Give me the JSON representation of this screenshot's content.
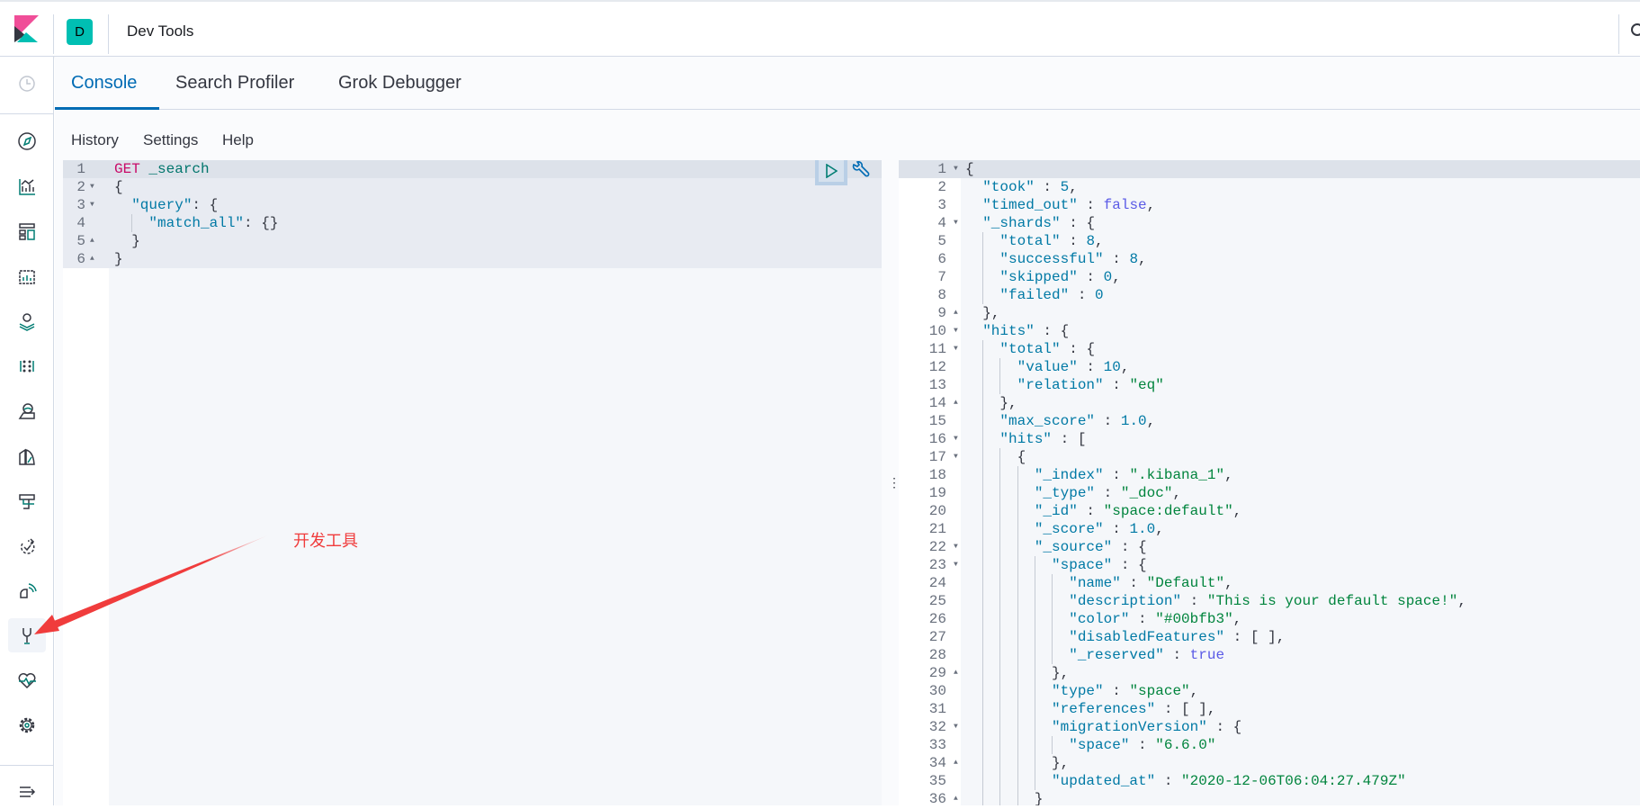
{
  "header": {
    "app_title": "Dev Tools",
    "space_initial": "D",
    "space_color": "#00bfb3"
  },
  "sidebar": {
    "items": [
      {
        "name": "recently-viewed",
        "icon": "clock-icon"
      },
      {
        "name": "discover",
        "icon": "compass-icon"
      },
      {
        "name": "visualize",
        "icon": "chart-icon"
      },
      {
        "name": "dashboard",
        "icon": "dashboard-icon"
      },
      {
        "name": "canvas",
        "icon": "canvas-icon"
      },
      {
        "name": "maps",
        "icon": "map-pin-icon"
      },
      {
        "name": "machine-learning",
        "icon": "ml-icon"
      },
      {
        "name": "siem",
        "icon": "siem-icon"
      },
      {
        "name": "logs",
        "icon": "logs-icon"
      },
      {
        "name": "infrastructure",
        "icon": "infra-icon"
      },
      {
        "name": "apm",
        "icon": "apm-icon"
      },
      {
        "name": "uptime",
        "icon": "uptime-icon"
      },
      {
        "name": "dev-tools",
        "icon": "wrench-icon",
        "active": true
      },
      {
        "name": "monitoring",
        "icon": "heartbeat-icon"
      },
      {
        "name": "management",
        "icon": "gear-icon"
      },
      {
        "name": "collapse",
        "icon": "collapse-menu-icon"
      }
    ]
  },
  "tabs": [
    {
      "label": "Console",
      "active": true
    },
    {
      "label": "Search Profiler"
    },
    {
      "label": "Grok Debugger"
    }
  ],
  "menu": {
    "history": "History",
    "settings": "Settings",
    "help": "Help"
  },
  "request": {
    "lines": [
      "GET _search",
      "{",
      "  \"query\": {",
      "    \"match_all\": {}",
      "  }",
      "}"
    ],
    "folds": [
      "",
      "open",
      "open",
      "",
      "close",
      "close"
    ]
  },
  "response": {
    "lines": [
      "{",
      "  \"took\" : 5,",
      "  \"timed_out\" : false,",
      "  \"_shards\" : {",
      "    \"total\" : 8,",
      "    \"successful\" : 8,",
      "    \"skipped\" : 0,",
      "    \"failed\" : 0",
      "  },",
      "  \"hits\" : {",
      "    \"total\" : {",
      "      \"value\" : 10,",
      "      \"relation\" : \"eq\"",
      "    },",
      "    \"max_score\" : 1.0,",
      "    \"hits\" : [",
      "      {",
      "        \"_index\" : \".kibana_1\",",
      "        \"_type\" : \"_doc\",",
      "        \"_id\" : \"space:default\",",
      "        \"_score\" : 1.0,",
      "        \"_source\" : {",
      "          \"space\" : {",
      "            \"name\" : \"Default\",",
      "            \"description\" : \"This is your default space!\",",
      "            \"color\" : \"#00bfb3\",",
      "            \"disabledFeatures\" : [ ],",
      "            \"_reserved\" : true",
      "          },",
      "          \"type\" : \"space\",",
      "          \"references\" : [ ],",
      "          \"migrationVersion\" : {",
      "            \"space\" : \"6.6.0\"",
      "          },",
      "          \"updated_at\" : \"2020-12-06T06:04:27.479Z\"",
      "        }"
    ],
    "folds": [
      "open",
      "",
      "",
      "open",
      "",
      "",
      "",
      "",
      "close",
      "open",
      "open",
      "",
      "",
      "close",
      "",
      "open",
      "open",
      "",
      "",
      "",
      "",
      "open",
      "open",
      "",
      "",
      "",
      "",
      "",
      "close",
      "",
      "",
      "open",
      "",
      "close",
      "",
      "close"
    ]
  },
  "annotation": {
    "text": "开发工具",
    "color": "#f03c3c"
  },
  "colors": {
    "accent": "#006bb4",
    "play": "#017d73",
    "wrench": "#006bb4"
  }
}
